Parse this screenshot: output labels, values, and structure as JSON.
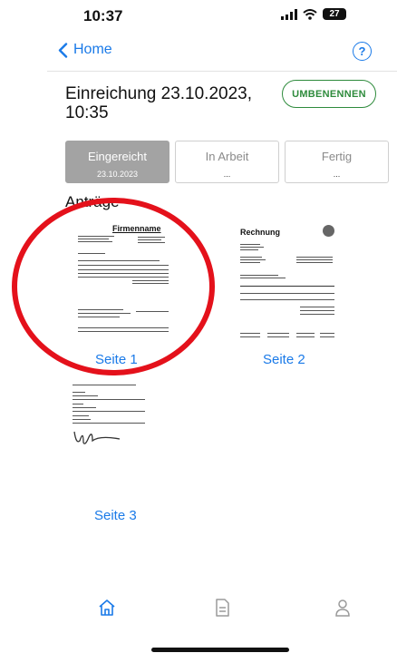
{
  "status": {
    "time": "10:37",
    "battery": "27"
  },
  "nav": {
    "back_label": "Home",
    "help": "?"
  },
  "header": {
    "title": "Einreichung 23.10.2023, 10:35",
    "rename_label": "UMBENENNEN"
  },
  "tabs": [
    {
      "label": "Eingereicht",
      "sub": "23.10.2023",
      "active": true
    },
    {
      "label": "In Arbeit",
      "sub": "..."
    },
    {
      "label": "Fertig",
      "sub": "..."
    }
  ],
  "section_title": "Anträge",
  "pages": [
    {
      "label": "Seite 1",
      "doc_heading": "Firmenname"
    },
    {
      "label": "Seite 2",
      "doc_heading": "Rechnung"
    },
    {
      "label": "Seite 3"
    }
  ],
  "bottom_tabs": [
    "home-icon",
    "document-icon",
    "person-icon"
  ],
  "colors": {
    "accent": "#1a7ae8",
    "green": "#2e8b3c",
    "annotation": "#e4111b"
  }
}
